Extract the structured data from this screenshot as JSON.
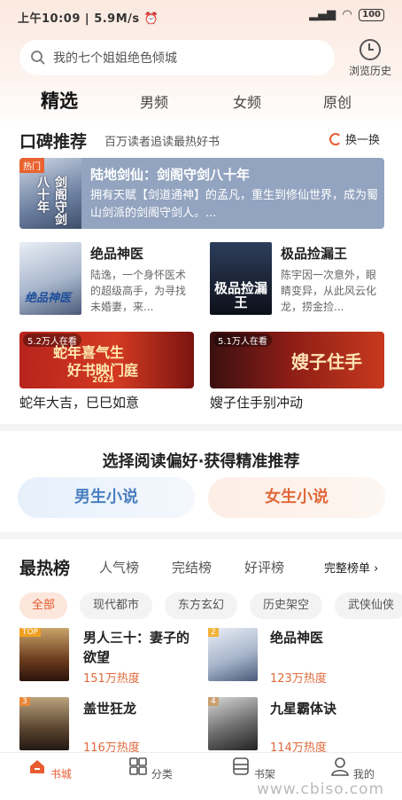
{
  "status": {
    "time": "上午10:09",
    "speed": "5.9M/s",
    "battery": "100"
  },
  "search": {
    "placeholder": "我的七个姐姐绝色倾城"
  },
  "header": {
    "history_label": "浏览历史"
  },
  "tabs": [
    "精选",
    "男频",
    "女频",
    "原创"
  ],
  "koubei": {
    "title": "口碑推荐",
    "subtitle": "百万读者追读最热好书",
    "refresh": "换一换",
    "featured": {
      "tag": "热门",
      "cover_text": "剑阁守剑八十年",
      "title": "陆地剑仙：剑阁守剑八十年",
      "desc": "拥有天赋【剑道通神】的孟凡，重生到修仙世界，成为蜀山剑派的剑阁守剑人。..."
    },
    "books": [
      {
        "title": "绝品神医",
        "desc": "陆逸，一个身怀医术的超级高手，为寻找未婚妻，来...",
        "cover_text": "绝品神医"
      },
      {
        "title": "极品捡漏王",
        "desc": "陈宇因一次意外，眼睛变异，从此风云化龙，捞金捡...",
        "cover_text": "极品捡漏王"
      }
    ],
    "banners": [
      {
        "badge": "5.2万人在看",
        "art": "蛇年喜气生",
        "art2": "好书映门庭",
        "art3": "2025",
        "caption": "蛇年大吉，巳巳如意"
      },
      {
        "badge": "5.1万人在看",
        "art": "嫂子住手",
        "art2": "",
        "art3": "",
        "caption": "嫂子住手别冲动"
      }
    ]
  },
  "preference": {
    "title": "选择阅读偏好·获得精准推荐",
    "male": "男生小说",
    "female": "女生小说"
  },
  "ranking": {
    "title": "最热榜",
    "tabs": [
      "人气榜",
      "完结榜",
      "好评榜"
    ],
    "more": "完整榜单 ›",
    "chips": [
      "全部",
      "现代都市",
      "东方玄幻",
      "历史架空",
      "武侠仙侠"
    ],
    "books": [
      {
        "title": "男人三十：妻子的欲望",
        "heat": "151万热度",
        "rank": "TOP"
      },
      {
        "title": "绝品神医",
        "heat": "123万热度",
        "rank": "2"
      },
      {
        "title": "盖世狂龙",
        "heat": "116万热度",
        "rank": "3"
      },
      {
        "title": "九星霸体诀",
        "heat": "114万热度",
        "rank": "4"
      }
    ]
  },
  "bottom_nav": [
    "书城",
    "分类",
    "书架",
    "我的"
  ],
  "watermark": "www.cbiso.com",
  "colors": {
    "accent": "#e85c32",
    "featured_bg": "#93a4c0"
  }
}
